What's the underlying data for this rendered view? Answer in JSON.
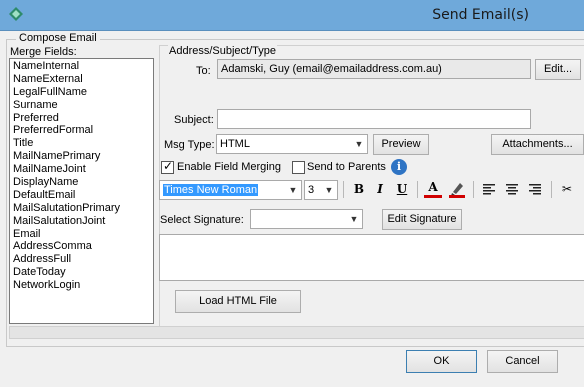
{
  "window": {
    "title": "Send Email(s)"
  },
  "compose": {
    "group_label": "Compose Email",
    "merge_fields_label": "Merge Fields:",
    "merge_fields": [
      "NameInternal",
      "NameExternal",
      "LegalFullName",
      "Surname",
      "Preferred",
      "PreferredFormal",
      "Title",
      "MailNamePrimary",
      "MailNameJoint",
      "DisplayName",
      "DefaultEmail",
      "MailSalutationPrimary",
      "MailSalutationJoint",
      "Email",
      "AddressComma",
      "AddressFull",
      "DateToday",
      "NetworkLogin"
    ]
  },
  "address": {
    "section_label": "Address/Subject/Type",
    "to_label": "To:",
    "to_value": "Adamski, Guy  (email@emailaddress.com.au)",
    "edit_label": "Edit...",
    "subject_label": "Subject:",
    "subject_value": "",
    "msg_type_label": "Msg Type:",
    "msg_type_value": "HTML",
    "preview_label": "Preview",
    "attachments_label": "Attachments..."
  },
  "options": {
    "enable_merging_label": "Enable Field Merging",
    "enable_merging_checked": true,
    "send_to_parents_label": "Send to Parents",
    "send_to_parents_checked": false,
    "info_glyph": "i"
  },
  "format_toolbar": {
    "font_value": "Times New Roman",
    "size_value": "3",
    "bold": "B",
    "italic": "I",
    "underline": "U",
    "font_color": "A",
    "icons": [
      "bold-icon",
      "italic-icon",
      "underline-icon",
      "font-color-icon",
      "highlight-icon",
      "align-left-icon",
      "align-center-icon",
      "align-right-icon",
      "cut-icon"
    ],
    "font_color_hex": "#d00000",
    "highlight_hex": "#d00000"
  },
  "signature": {
    "label": "Select Signature:",
    "value": "",
    "edit_label": "Edit Signature"
  },
  "body": {
    "text": ""
  },
  "load_html_label": "Load HTML File",
  "footer": {
    "ok_label": "OK",
    "cancel_label": "Cancel"
  }
}
